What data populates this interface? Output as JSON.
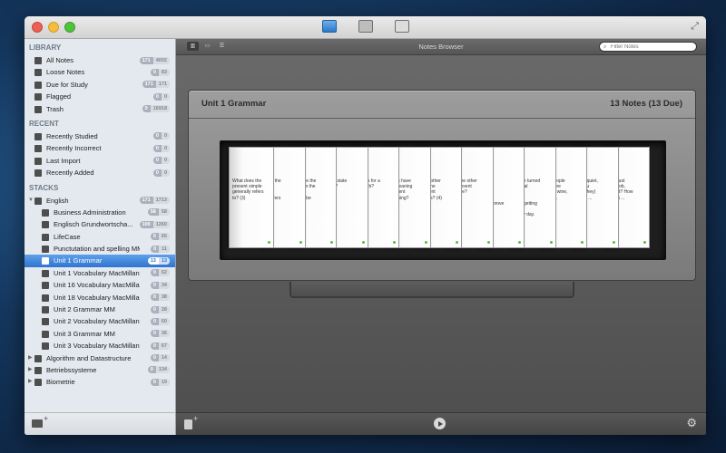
{
  "window": {
    "title": "Notes Browser"
  },
  "sidebar": {
    "library_header": "LIBRARY",
    "library": [
      {
        "label": "All Notes",
        "badge": [
          "171",
          "4002"
        ],
        "icon": "all-notes-icon"
      },
      {
        "label": "Loose Notes",
        "badge": [
          "0",
          "83"
        ],
        "icon": "loose-notes-icon"
      },
      {
        "label": "Due for Study",
        "badge": [
          "171",
          "171"
        ],
        "icon": "calendar-icon"
      },
      {
        "label": "Flagged",
        "badge": [
          "0",
          "0"
        ],
        "icon": "flag-icon"
      },
      {
        "label": "Trash",
        "badge": [
          "0",
          "16918"
        ],
        "icon": "trash-icon"
      }
    ],
    "recent_header": "RECENT",
    "recent": [
      {
        "label": "Recently Studied",
        "badge": [
          "0",
          "0"
        ],
        "icon": "clock-icon"
      },
      {
        "label": "Recently Incorrect",
        "badge": [
          "0",
          "0"
        ],
        "icon": "warning-icon"
      },
      {
        "label": "Last Import",
        "badge": [
          "0",
          "0"
        ],
        "icon": "import-icon"
      },
      {
        "label": "Recently Added",
        "badge": [
          "0",
          "0"
        ],
        "icon": "plus-circle-icon"
      }
    ],
    "stacks_header": "STACKS",
    "stacks": [
      {
        "label": "English",
        "badge": [
          "171",
          "1713"
        ],
        "level": 0,
        "expanded": true
      },
      {
        "label": "Business Administration",
        "badge": [
          "58",
          "58"
        ],
        "level": 1
      },
      {
        "label": "Englisch Grundwortscha...",
        "badge": [
          "100",
          "1260"
        ],
        "level": 1
      },
      {
        "label": "LifeCase",
        "badge": [
          "0",
          "65"
        ],
        "level": 1
      },
      {
        "label": "Punctutation and spelling MM",
        "badge": [
          "0",
          "11"
        ],
        "level": 1
      },
      {
        "label": "Unit 1 Grammar",
        "badge": [
          "13",
          "13"
        ],
        "level": 1,
        "selected": true
      },
      {
        "label": "Unit 1 Vocabulary MacMillan",
        "badge": [
          "0",
          "62"
        ],
        "level": 1
      },
      {
        "label": "Unit 16 Vocabulary MacMillan",
        "badge": [
          "0",
          "34"
        ],
        "level": 1
      },
      {
        "label": "Unit 18 Vocabulary MacMillan",
        "badge": [
          "0",
          "38"
        ],
        "level": 1
      },
      {
        "label": "Unit 2 Grammar MM",
        "badge": [
          "0",
          "28"
        ],
        "level": 1
      },
      {
        "label": "Unit 2 Vocabulary MacMillan",
        "badge": [
          "0",
          "60"
        ],
        "level": 1
      },
      {
        "label": "Unit 3 Grammar MM",
        "badge": [
          "0",
          "36"
        ],
        "level": 1
      },
      {
        "label": "Unit 3 Vocabulary MacMillan",
        "badge": [
          "0",
          "67"
        ],
        "level": 1
      },
      {
        "label": "Algorithm and Datastructure",
        "badge": [
          "0",
          "14"
        ],
        "level": 0,
        "expanded": false
      },
      {
        "label": "Betriebssysteme",
        "badge": [
          "0",
          "134"
        ],
        "level": 0,
        "expanded": false
      },
      {
        "label": "Biometrie",
        "badge": [
          "0",
          "19"
        ],
        "level": 0,
        "expanded": false
      }
    ]
  },
  "search": {
    "placeholder": "Filter Notes"
  },
  "panel": {
    "title": "Unit 1 Grammar",
    "count": "13 Notes (13 Due)"
  },
  "cards": [
    "What does the\npresent simple\ngenerally refers\nto? (3)",
    "does the\nit\nuous\nlly refers",
    "can be the\na from the\nt\nuous be\n(3)",
    "t is a state\nverb?",
    "mples for a\nte verb?",
    "verbs have\nve meaning\ndifferent\nmeaning?",
    "t are other\ne of the\npresent\nnuous? (4)",
    "are the other\nof present\nsimple?",
    "year\nor I'm\ng\n\nto improve\nglish.",
    "ve we turned\ncentral\ng\n\n/ It's getting\n\nevery day.",
    "ch people\n... more\nmore wine,\nerally.",
    "e be quiet,\nk. You\nle? (they)\nrday) ...",
    "only just\nl the job,\nt it yet? How\nnt on) ..."
  ]
}
